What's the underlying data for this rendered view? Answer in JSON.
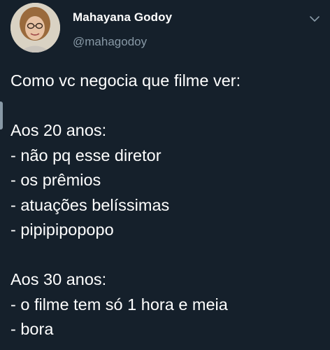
{
  "tweet": {
    "author": {
      "display_name": "Mahayana Godoy",
      "handle": "@mahagodoy"
    },
    "lines": [
      "Como vc negocia que filme ver:",
      "",
      "Aos 20 anos:",
      "- não pq esse diretor",
      "- os prêmios",
      "- atuações belíssimas",
      "- pipipipopopo",
      "",
      "Aos 30 anos:",
      "- o filme tem só 1 hora e meia",
      "- bora"
    ]
  },
  "icons": {
    "avatar": "profile-photo",
    "menu": "chevron-down-icon"
  },
  "colors": {
    "background": "#15202b",
    "primary_text": "#ffffff",
    "secondary_text": "#8899a6"
  }
}
